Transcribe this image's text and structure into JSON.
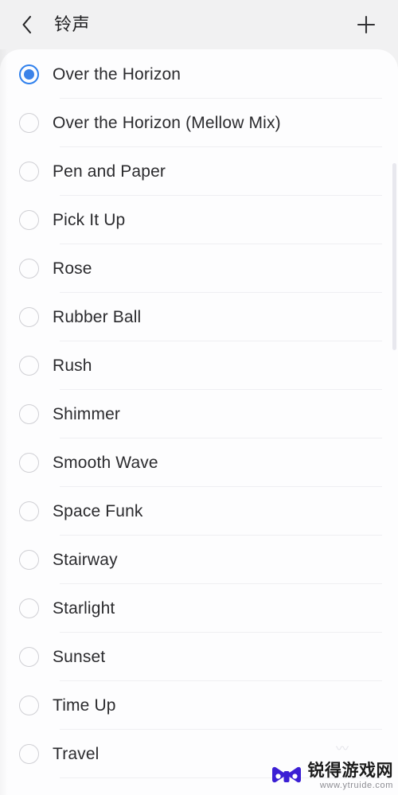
{
  "header": {
    "back_icon": "chevron-left-icon",
    "title": "铃声",
    "add_icon": "plus-icon"
  },
  "colors": {
    "accent": "#3b82e8",
    "header_bg": "#f1f1f2",
    "card_bg": "#fdfdfe",
    "text": "#2b2b2e",
    "divider": "#efeff2",
    "radio_border": "#cfcfd4",
    "scrollbar": "#e8e8ee",
    "watermark_logo": "#3b1fd4"
  },
  "list": {
    "selected_index": 0,
    "items": [
      {
        "label": "Over the Horizon",
        "selected": true
      },
      {
        "label": "Over the Horizon (Mellow Mix)",
        "selected": false
      },
      {
        "label": "Pen and Paper",
        "selected": false
      },
      {
        "label": "Pick It Up",
        "selected": false
      },
      {
        "label": "Rose",
        "selected": false
      },
      {
        "label": "Rubber Ball",
        "selected": false
      },
      {
        "label": "Rush",
        "selected": false
      },
      {
        "label": "Shimmer",
        "selected": false
      },
      {
        "label": "Smooth Wave",
        "selected": false
      },
      {
        "label": "Space Funk",
        "selected": false
      },
      {
        "label": "Stairway",
        "selected": false
      },
      {
        "label": "Starlight",
        "selected": false
      },
      {
        "label": "Sunset",
        "selected": false
      },
      {
        "label": "Time Up",
        "selected": false
      },
      {
        "label": "Travel",
        "selected": false
      }
    ]
  },
  "scrollbar": {
    "visible": true
  },
  "watermark": {
    "title": "锐得游戏网",
    "url": "www.ytruide.com",
    "logo_icon": "gamepad-bowtie-icon"
  }
}
